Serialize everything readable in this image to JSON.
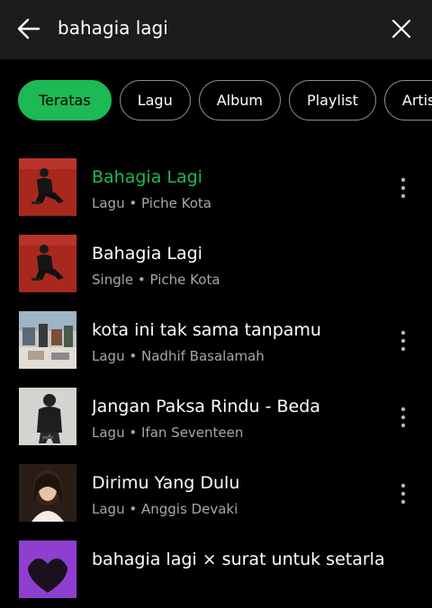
{
  "search": {
    "query": "bahagia lagi"
  },
  "filters": [
    {
      "label": "Teratas",
      "active": true
    },
    {
      "label": "Lagu",
      "active": false
    },
    {
      "label": "Album",
      "active": false
    },
    {
      "label": "Playlist",
      "active": false
    },
    {
      "label": "Artis",
      "active": false
    }
  ],
  "results": [
    {
      "title": "Bahagia Lagi",
      "type": "Lagu",
      "separator": "•",
      "artist": "Piche Kota",
      "playing": true,
      "has_more": true
    },
    {
      "title": "Bahagia Lagi",
      "type": "Single",
      "separator": "•",
      "artist": "Piche Kota",
      "playing": false,
      "has_more": false
    },
    {
      "title": "kota ini tak sama tanpamu",
      "type": "Lagu",
      "separator": "•",
      "artist": "Nadhif Basalamah",
      "playing": false,
      "has_more": true
    },
    {
      "title": "Jangan Paksa Rindu - Beda",
      "type": "Lagu",
      "separator": "•",
      "artist": "Ifan Seventeen",
      "playing": false,
      "has_more": true
    },
    {
      "title": "Dirimu Yang Dulu",
      "type": "Lagu",
      "separator": "•",
      "artist": "Anggis Devaki",
      "playing": false,
      "has_more": true
    },
    {
      "title": "bahagia lagi × surat untuk setarla",
      "type": "",
      "separator": "",
      "artist": "",
      "playing": false,
      "has_more": false
    }
  ],
  "colors": {
    "accent": "#1db954",
    "background": "#000000",
    "search_bar": "#1c1c1c",
    "secondary_text": "#a7a7a7"
  },
  "icons": {
    "back": "arrow-left-icon",
    "clear": "close-icon",
    "more": "more-vertical-icon"
  }
}
